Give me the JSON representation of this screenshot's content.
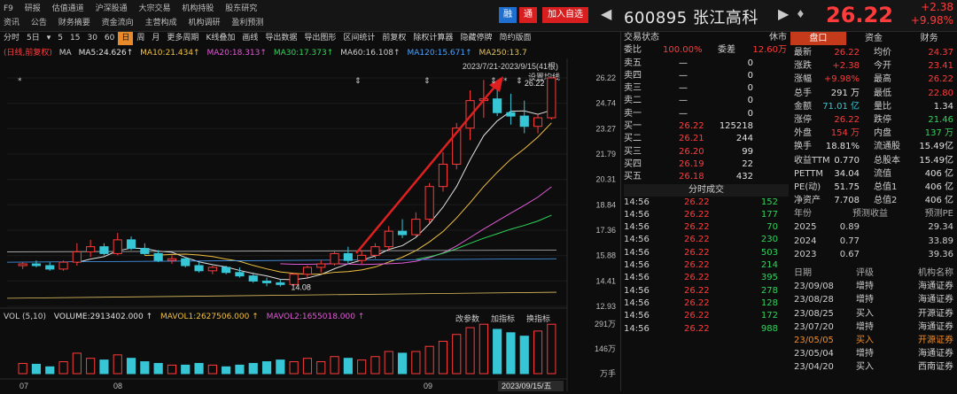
{
  "menu": {
    "row1": [
      "F9",
      "研报",
      "估值通道",
      "沪深股通",
      "大宗交易",
      "机构持股",
      "股东研究"
    ],
    "row2": [
      "资讯",
      "公告",
      "财务摘要",
      "资金流向",
      "主营构成",
      "机构调研",
      "盈利预测"
    ]
  },
  "header": {
    "badge_margin": "融",
    "badge_warn": "通",
    "add_watch": "加入自选",
    "prev": "◀",
    "code_name": "600895 张江高科",
    "next": "▶",
    "bell": "♦",
    "price": "26.22",
    "change": "+2.38",
    "change_pct": "+9.98%"
  },
  "toolbar": {
    "items": [
      "分时",
      "5日",
      "▾",
      "5",
      "15",
      "30",
      "60",
      "日",
      "周",
      "月",
      "更多周期",
      "K线叠加",
      "画线",
      "导出数据",
      "导出图形",
      "区间统计",
      "前复权",
      "除权计算器",
      "隐藏停牌",
      "简约版面"
    ],
    "active": "日"
  },
  "ma": {
    "adjust": "(日线,前复权)",
    "ma_label": "MA",
    "ma5": "MA5:24.626↑",
    "ma10": "MA10:21.434↑",
    "ma20": "MA20:18.313↑",
    "ma30": "MA30:17.373↑",
    "ma60": "MA60:16.108↑",
    "ma120": "MA120:15.671↑",
    "ma250": "MA250:13.7",
    "range": "2023/7/21-2023/9/15(41根)",
    "setting": "设置均线"
  },
  "chart_data": {
    "type": "candlestick",
    "yticks": [
      "26.22",
      "24.74",
      "23.27",
      "21.79",
      "20.31",
      "18.84",
      "17.36",
      "15.88",
      "14.41",
      "12.93"
    ],
    "xticks": [
      "07",
      "08",
      "09"
    ],
    "max_label": "26.22",
    "min_label": "14.08",
    "date_label": "2023/09/15/五",
    "candles": [
      [
        15.3,
        15.5,
        15.1,
        15.4
      ],
      [
        15.4,
        15.6,
        15.2,
        15.3
      ],
      [
        15.3,
        15.5,
        15.0,
        15.1
      ],
      [
        15.1,
        15.6,
        15.0,
        15.5
      ],
      [
        15.5,
        16.6,
        15.3,
        16.1
      ],
      [
        16.1,
        16.8,
        15.8,
        16.4
      ],
      [
        16.4,
        16.6,
        15.9,
        16.0
      ],
      [
        16.0,
        17.2,
        15.9,
        16.8
      ],
      [
        16.8,
        17.0,
        16.2,
        16.3
      ],
      [
        16.3,
        16.6,
        15.9,
        16.0
      ],
      [
        16.0,
        16.2,
        15.5,
        15.6
      ],
      [
        15.6,
        15.9,
        15.4,
        15.7
      ],
      [
        15.7,
        15.8,
        15.2,
        15.3
      ],
      [
        15.3,
        15.5,
        14.9,
        15.0
      ],
      [
        15.0,
        15.3,
        14.8,
        15.2
      ],
      [
        15.2,
        15.3,
        14.8,
        14.9
      ],
      [
        14.9,
        15.2,
        14.6,
        14.7
      ],
      [
        14.7,
        14.9,
        14.3,
        14.4
      ],
      [
        14.4,
        14.6,
        14.1,
        14.3
      ],
      [
        14.3,
        14.5,
        14.08,
        14.2
      ],
      [
        14.2,
        14.9,
        14.1,
        14.8
      ],
      [
        14.8,
        15.3,
        14.6,
        15.2
      ],
      [
        15.2,
        15.6,
        14.9,
        15.4
      ],
      [
        15.4,
        16.2,
        15.3,
        16.0
      ],
      [
        16.0,
        16.4,
        15.4,
        15.6
      ],
      [
        15.6,
        16.2,
        15.4,
        15.9
      ],
      [
        15.9,
        16.6,
        15.7,
        16.4
      ],
      [
        16.4,
        17.6,
        16.2,
        17.3
      ],
      [
        17.3,
        18.0,
        16.9,
        17.1
      ],
      [
        17.1,
        18.4,
        17.0,
        18.0
      ],
      [
        18.0,
        20.1,
        17.8,
        19.9
      ],
      [
        19.9,
        21.9,
        19.6,
        21.2
      ],
      [
        21.2,
        23.6,
        20.9,
        23.3
      ],
      [
        23.3,
        25.5,
        22.6,
        24.9
      ],
      [
        24.9,
        26.1,
        23.9,
        25.0
      ],
      [
        25.0,
        25.8,
        24.0,
        24.2
      ],
      [
        24.2,
        25.3,
        23.5,
        24.0
      ],
      [
        24.0,
        24.9,
        23.0,
        23.4
      ],
      [
        23.4,
        24.1,
        23.0,
        23.9
      ],
      [
        23.9,
        26.22,
        23.8,
        26.22
      ]
    ],
    "volumes": [
      0.6,
      0.55,
      0.4,
      0.7,
      1.2,
      0.9,
      0.8,
      1.1,
      0.9,
      0.7,
      0.6,
      0.5,
      0.5,
      0.6,
      0.5,
      0.4,
      0.5,
      0.6,
      0.7,
      0.8,
      0.7,
      0.9,
      0.7,
      1.0,
      0.9,
      0.8,
      1.0,
      1.3,
      1.2,
      1.3,
      1.6,
      1.9,
      2.3,
      2.7,
      2.9,
      2.6,
      2.4,
      2.2,
      2.5,
      2.9
    ]
  },
  "volume": {
    "label": "VOL (5,10)",
    "volume": "VOLUME:2913402.000 ↑",
    "mavol1": "MAVOL1:2627506.000 ↑",
    "mavol2": "MAVOL2:1655018.000 ↑",
    "btn_params": "改参数",
    "btn_add": "加指标",
    "btn_switch": "换指标",
    "yticks": [
      "291万",
      "146万",
      "万手"
    ]
  },
  "orderbook": {
    "title": "交易状态",
    "status": "休市",
    "wb_label": "委比",
    "wb_value": "100.00%",
    "wc_label": "委差",
    "wc_value": "12.60万",
    "sells": [
      {
        "label": "卖五",
        "price": "—",
        "vol": "0"
      },
      {
        "label": "卖四",
        "price": "—",
        "vol": "0"
      },
      {
        "label": "卖三",
        "price": "—",
        "vol": "0"
      },
      {
        "label": "卖二",
        "price": "—",
        "vol": "0"
      },
      {
        "label": "卖一",
        "price": "—",
        "vol": "0"
      }
    ],
    "buys": [
      {
        "label": "买一",
        "price": "26.22",
        "vol": "125218"
      },
      {
        "label": "买二",
        "price": "26.21",
        "vol": "244"
      },
      {
        "label": "买三",
        "price": "26.20",
        "vol": "99"
      },
      {
        "label": "买四",
        "price": "26.19",
        "vol": "22"
      },
      {
        "label": "买五",
        "price": "26.18",
        "vol": "432"
      }
    ],
    "trades_title": "分时成交",
    "trades": [
      {
        "t": "14:56",
        "p": "26.22",
        "v": "152"
      },
      {
        "t": "14:56",
        "p": "26.22",
        "v": "177"
      },
      {
        "t": "14:56",
        "p": "26.22",
        "v": "70"
      },
      {
        "t": "14:56",
        "p": "26.22",
        "v": "230"
      },
      {
        "t": "14:56",
        "p": "26.22",
        "v": "503"
      },
      {
        "t": "14:56",
        "p": "26.22",
        "v": "214"
      },
      {
        "t": "14:56",
        "p": "26.22",
        "v": "395"
      },
      {
        "t": "14:56",
        "p": "26.22",
        "v": "278"
      },
      {
        "t": "14:56",
        "p": "26.22",
        "v": "128"
      },
      {
        "t": "14:56",
        "p": "26.22",
        "v": "172"
      },
      {
        "t": "14:56",
        "p": "26.22",
        "v": "988"
      }
    ]
  },
  "tabs": [
    "盘口",
    "资金",
    "财务"
  ],
  "stats": [
    {
      "l1": "最新",
      "v1": "26.22",
      "l2": "均价",
      "v2": "24.37",
      "c1": "red",
      "c2": "red"
    },
    {
      "l1": "涨跌",
      "v1": "+2.38",
      "l2": "今开",
      "v2": "23.41",
      "c1": "red",
      "c2": "red"
    },
    {
      "l1": "涨幅",
      "v1": "+9.98%",
      "l2": "最高",
      "v2": "26.22",
      "c1": "red",
      "c2": "red"
    },
    {
      "l1": "总手",
      "v1": "291 万",
      "l2": "最低",
      "v2": "22.80",
      "c1": "white",
      "c2": "red"
    },
    {
      "l1": "金额",
      "v1": "71.01 亿",
      "l2": "量比",
      "v2": "1.34",
      "c1": "cyan",
      "c2": "white"
    },
    {
      "l1": "涨停",
      "v1": "26.22",
      "l2": "跌停",
      "v2": "21.46",
      "c1": "red",
      "c2": "green"
    },
    {
      "l1": "外盘",
      "v1": "154 万",
      "l2": "内盘",
      "v2": "137 万",
      "c1": "red",
      "c2": "green"
    },
    {
      "l1": "换手",
      "v1": "18.81%",
      "l2": "流通股",
      "v2": "15.49亿",
      "c1": "white",
      "c2": "white"
    },
    {
      "l1": "收益TTM",
      "v1": "0.770",
      "l2": "总股本",
      "v2": "15.49亿",
      "c1": "white",
      "c2": "white"
    },
    {
      "l1": "PETTM",
      "v1": "34.04",
      "l2": "流值",
      "v2": "406 亿",
      "c1": "white",
      "c2": "white"
    },
    {
      "l1": "PE(动)",
      "v1": "51.75",
      "l2": "总值1",
      "v2": "406 亿",
      "c1": "white",
      "c2": "white"
    },
    {
      "l1": "净资产",
      "v1": "7.708",
      "l2": "总值2",
      "v2": "406 亿",
      "c1": "white",
      "c2": "white"
    }
  ],
  "forecast": {
    "headers": [
      "年份",
      "预测收益",
      "预测PE"
    ],
    "rows": [
      [
        "2025",
        "0.89",
        "29.34"
      ],
      [
        "2024",
        "0.77",
        "33.89"
      ],
      [
        "2023",
        "0.67",
        "39.36"
      ]
    ]
  },
  "ratings": {
    "headers": [
      "日期",
      "评级",
      "机构名称"
    ],
    "rows": [
      {
        "d": "23/09/08",
        "r": "增持",
        "o": "海通证券",
        "c": "white"
      },
      {
        "d": "23/08/28",
        "r": "增持",
        "o": "海通证券",
        "c": "white"
      },
      {
        "d": "23/08/25",
        "r": "买入",
        "o": "开源证券",
        "c": "white"
      },
      {
        "d": "23/07/20",
        "r": "增持",
        "o": "海通证券",
        "c": "white"
      },
      {
        "d": "23/05/05",
        "r": "买入",
        "o": "开源证券",
        "c": "orange"
      },
      {
        "d": "23/05/04",
        "r": "增持",
        "o": "海通证券",
        "c": "white"
      },
      {
        "d": "23/04/20",
        "r": "买入",
        "o": "西南证券",
        "c": "white"
      }
    ]
  }
}
